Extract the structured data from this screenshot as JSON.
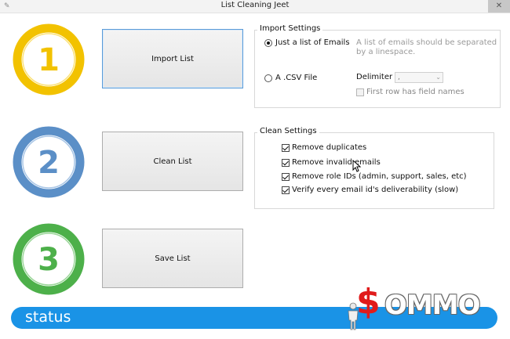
{
  "window": {
    "title": "List Cleaning Jeet",
    "close_glyph": "✕",
    "app_icon": "feather-icon"
  },
  "steps": [
    {
      "number": "1",
      "color": "#f2c200",
      "button_label": "Import List"
    },
    {
      "number": "2",
      "color": "#5b8fc7",
      "button_label": "Clean List"
    },
    {
      "number": "3",
      "color": "#4db04a",
      "button_label": "Save List"
    }
  ],
  "import_settings": {
    "legend": "Import Settings",
    "option_emails": "Just a list of Emails",
    "option_emails_selected": true,
    "option_emails_hint": "A list of emails should be separated by a linespace.",
    "option_csv": "A .CSV File",
    "option_csv_selected": false,
    "delimiter_label": "Delimiter",
    "delimiter_value": ",",
    "first_row_label": "First row has field names",
    "first_row_checked": false
  },
  "clean_settings": {
    "legend": "Clean Settings",
    "options": [
      {
        "label": "Remove duplicates",
        "checked": true
      },
      {
        "label": "Remove invalid emails",
        "checked": true
      },
      {
        "label": "Remove role IDs (admin, support, sales, etc)",
        "checked": true
      },
      {
        "label": "Verify every email id's deliverability (slow)",
        "checked": true
      }
    ]
  },
  "status": {
    "text": "status",
    "bar_color": "#1a93e6"
  },
  "watermark": {
    "dollar": "$",
    "text": "OMMO"
  }
}
